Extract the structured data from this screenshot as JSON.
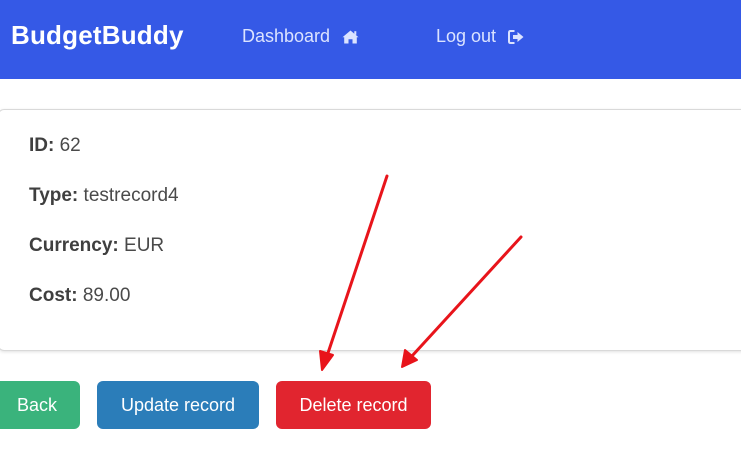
{
  "navbar": {
    "brand": "BudgetBuddy",
    "links": [
      {
        "label": "Dashboard",
        "icon": "home-icon"
      },
      {
        "label": "Log out",
        "icon": "sign-out-icon"
      }
    ],
    "colors": {
      "background": "#3559e6",
      "link": "#dbe3ff"
    }
  },
  "record": {
    "fields": [
      {
        "label": "ID:",
        "value": "62"
      },
      {
        "label": "Type:",
        "value": "testrecord4"
      },
      {
        "label": "Currency:",
        "value": "EUR"
      },
      {
        "label": "Cost:",
        "value": "89.00"
      }
    ]
  },
  "actions": {
    "back_label": "Back",
    "update_label": "Update record",
    "delete_label": "Delete record",
    "colors": {
      "back": "#3ab37c",
      "update": "#2b7db9",
      "delete": "#e1252f"
    }
  },
  "annotations": {
    "arrow_color": "#e8141b",
    "arrows": [
      "arrow-to-delete-button-left",
      "arrow-to-delete-button-right"
    ]
  }
}
